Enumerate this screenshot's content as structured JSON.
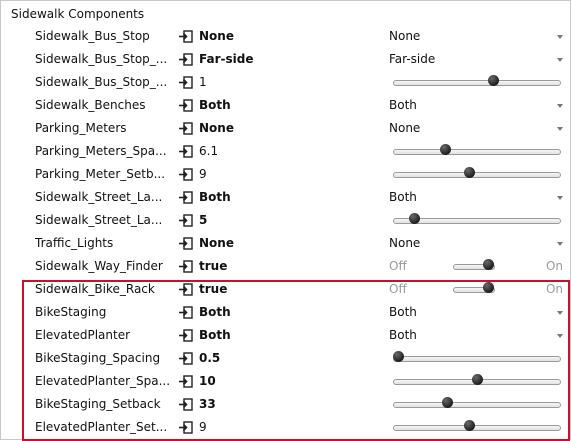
{
  "section_title": "Sidewalk Components",
  "highlight_color": "#c8102e",
  "rows": [
    {
      "label": "Sidewalk_Bus_Stop",
      "value": "None",
      "bold": true,
      "control": "select",
      "selected": "None"
    },
    {
      "label": "Sidewalk_Bus_Stop_...",
      "value": "Far-side",
      "bold": true,
      "control": "select",
      "selected": "Far-side"
    },
    {
      "label": "Sidewalk_Bus_Stop_...",
      "value": "1",
      "bold": false,
      "control": "slider",
      "level": 0.6
    },
    {
      "label": "Sidewalk_Benches",
      "value": "Both",
      "bold": true,
      "control": "select",
      "selected": "Both"
    },
    {
      "label": "Parking_Meters",
      "value": "None",
      "bold": true,
      "control": "select",
      "selected": "None"
    },
    {
      "label": "Parking_Meters_Spa...",
      "value": "6.1",
      "bold": false,
      "control": "slider",
      "level": 0.3
    },
    {
      "label": "Parking_Meter_Setb...",
      "value": "9",
      "bold": false,
      "control": "slider",
      "level": 0.45
    },
    {
      "label": "Sidewalk_Street_La...",
      "value": "Both",
      "bold": true,
      "control": "select",
      "selected": "Both"
    },
    {
      "label": "Sidewalk_Street_La...",
      "value": "5",
      "bold": true,
      "control": "slider",
      "level": 0.1
    },
    {
      "label": "Traffic_Lights",
      "value": "None",
      "bold": true,
      "control": "select",
      "selected": "None"
    },
    {
      "label": "Sidewalk_Way_Finder",
      "value": "true",
      "bold": true,
      "control": "toggle",
      "off": "Off",
      "on": "On"
    },
    {
      "label": "Sidewalk_Bike_Rack",
      "value": "true",
      "bold": true,
      "control": "toggle",
      "off": "Off",
      "on": "On"
    },
    {
      "label": "BikeStaging",
      "value": "Both",
      "bold": true,
      "control": "select",
      "selected": "Both"
    },
    {
      "label": "ElevatedPlanter",
      "value": "Both",
      "bold": true,
      "control": "select",
      "selected": "Both"
    },
    {
      "label": "BikeStaging_Spacing",
      "value": "0.5",
      "bold": true,
      "control": "slider",
      "level": 0.0
    },
    {
      "label": "ElevatedPlanter_Spa...",
      "value": "10",
      "bold": true,
      "control": "slider",
      "level": 0.5
    },
    {
      "label": "BikeStaging_Setback",
      "value": "33",
      "bold": true,
      "control": "slider",
      "level": 0.31
    },
    {
      "label": "ElevatedPlanter_Set...",
      "value": "9",
      "bold": false,
      "control": "slider",
      "level": 0.45
    }
  ]
}
